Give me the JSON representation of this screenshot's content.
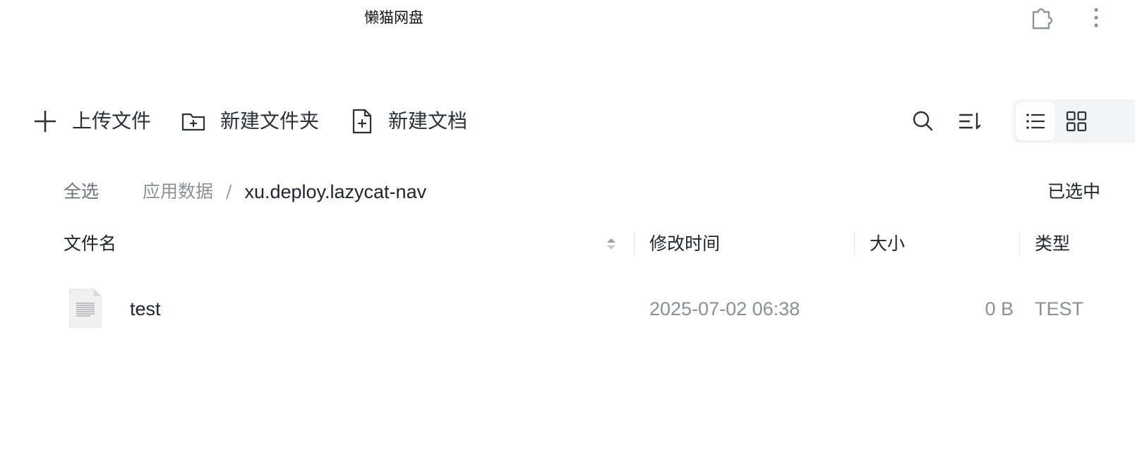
{
  "window": {
    "title": "懒猫网盘",
    "icons": {
      "extension": "puzzle-piece-icon",
      "menu": "vertical-dots-icon"
    }
  },
  "toolbar": {
    "upload": {
      "label": "上传文件",
      "icon": "plus-icon"
    },
    "new_folder": {
      "label": "新建文件夹",
      "icon": "folder-plus-icon"
    },
    "new_doc": {
      "label": "新建文档",
      "icon": "file-plus-icon"
    },
    "search_icon": "search-icon",
    "sort_icon": "sort-icon",
    "view_modes": [
      {
        "name": "list",
        "icon": "list-view-icon",
        "active": true
      },
      {
        "name": "grid",
        "icon": "grid-view-icon",
        "active": false
      }
    ]
  },
  "nav": {
    "select_all": "全选",
    "breadcrumb": {
      "root": "应用数据",
      "separator": "/",
      "current": "xu.deploy.lazycat-nav"
    },
    "selected_info": "已选中"
  },
  "table": {
    "headers": {
      "name": "文件名",
      "mtime": "修改时间",
      "size": "大小",
      "type": "类型"
    },
    "rows": [
      {
        "name": "test",
        "mtime": "2025-07-02 06:38",
        "size": "0 B",
        "type": "TEST",
        "icon": "document-file-icon"
      }
    ]
  },
  "colors": {
    "text_primary": "#1f2430",
    "text_secondary": "#8a8f99",
    "view_switch_bg": "#f3f4f6"
  }
}
